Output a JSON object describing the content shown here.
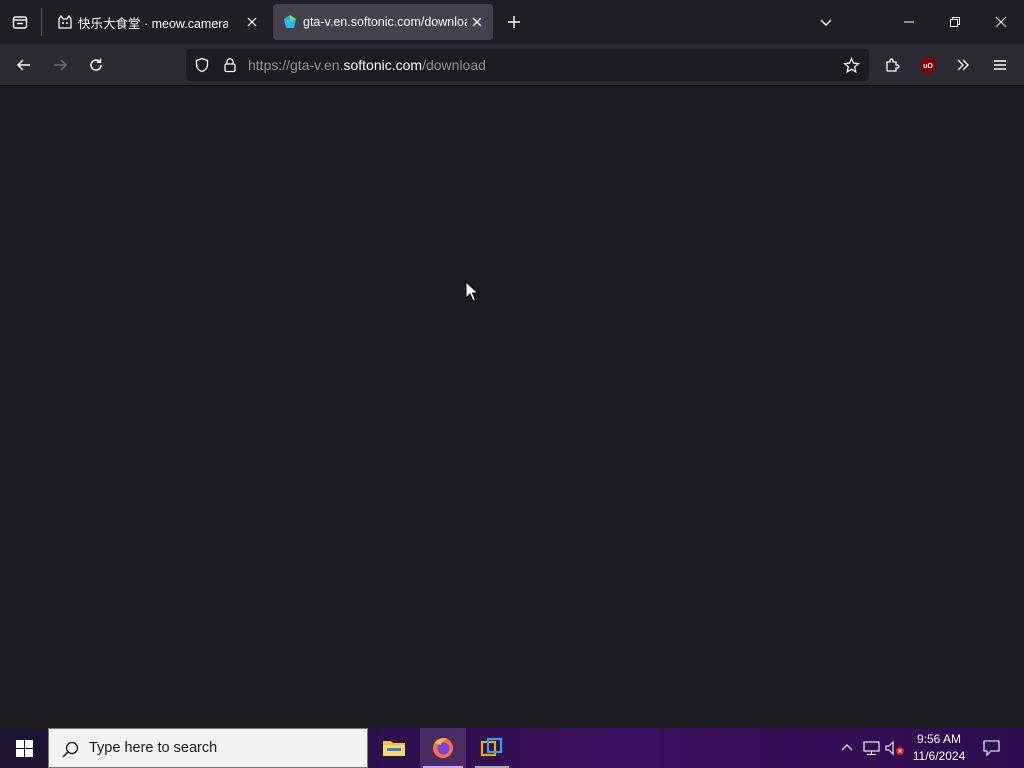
{
  "browser": {
    "tabs": [
      {
        "label": "快乐大食堂 · meow.camera",
        "active": false,
        "favicon": "cat-icon"
      },
      {
        "label": "gta-v.en.softonic.com/download",
        "active": true,
        "favicon": "softonic-icon"
      }
    ],
    "url": {
      "prefix": "https://gta-v.en.",
      "domain": "softonic.com",
      "path": "/download"
    }
  },
  "taskbar": {
    "search_placeholder": "Type here to search",
    "time": "9:56 AM",
    "date": "11/6/2024"
  },
  "colors": {
    "accent": "#8e63ff",
    "ublock": "#800000"
  }
}
